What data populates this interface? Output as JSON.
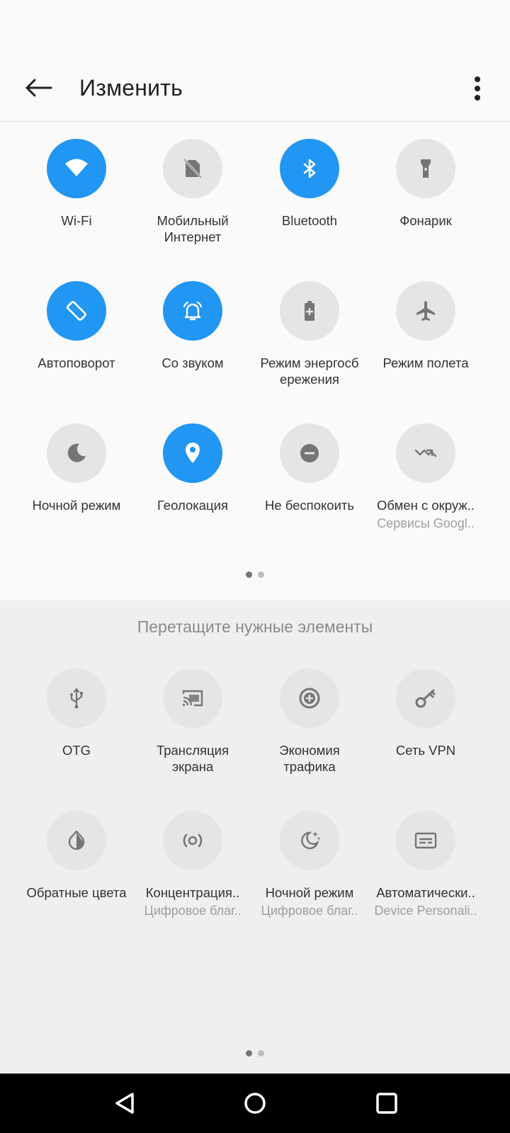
{
  "header": {
    "title": "Изменить"
  },
  "active_tiles": [
    {
      "name": "wifi",
      "label": "Wi-Fi",
      "sub": "",
      "on": true,
      "icon": "wifi-icon"
    },
    {
      "name": "mobile-data",
      "label": "Мобильный\nИнтернет",
      "sub": "",
      "on": false,
      "icon": "no-sim-icon"
    },
    {
      "name": "bluetooth",
      "label": "Bluetooth",
      "sub": "",
      "on": true,
      "icon": "bluetooth-icon"
    },
    {
      "name": "flashlight",
      "label": "Фонарик",
      "sub": "",
      "on": false,
      "icon": "flashlight-icon"
    },
    {
      "name": "autorotate",
      "label": "Автоповорот",
      "sub": "",
      "on": true,
      "icon": "rotate-icon"
    },
    {
      "name": "sound",
      "label": "Со звуком",
      "sub": "",
      "on": true,
      "icon": "bell-icon"
    },
    {
      "name": "battery-saver",
      "label": "Режим энергосб\nережения",
      "sub": "",
      "on": false,
      "icon": "battery-plus-icon"
    },
    {
      "name": "airplane",
      "label": "Режим полета",
      "sub": "",
      "on": false,
      "icon": "airplane-icon"
    },
    {
      "name": "night-mode",
      "label": "Ночной режим",
      "sub": "",
      "on": false,
      "icon": "moon-icon"
    },
    {
      "name": "location",
      "label": "Геолокация",
      "sub": "",
      "on": true,
      "icon": "location-pin-icon"
    },
    {
      "name": "dnd",
      "label": "Не беспокоить",
      "sub": "",
      "on": false,
      "icon": "minus-circle-icon"
    },
    {
      "name": "nearby-share",
      "label": "Обмен с окруж..",
      "sub": "Сервисы Googl..",
      "on": false,
      "icon": "nearby-share-icon"
    }
  ],
  "drag_hint": "Перетащите нужные элементы",
  "available_tiles": [
    {
      "name": "otg",
      "label": "OTG",
      "sub": "",
      "on": false,
      "icon": "usb-icon"
    },
    {
      "name": "cast",
      "label": "Трансляция\nэкрана",
      "sub": "",
      "on": false,
      "icon": "cast-icon"
    },
    {
      "name": "data-saver",
      "label": "Экономия\nтрафика",
      "sub": "",
      "on": false,
      "icon": "data-saver-icon"
    },
    {
      "name": "vpn",
      "label": "Сеть VPN",
      "sub": "",
      "on": false,
      "icon": "key-icon"
    },
    {
      "name": "invert-colors",
      "label": "Обратные цвета",
      "sub": "",
      "on": false,
      "icon": "invert-colors-icon"
    },
    {
      "name": "focus-mode",
      "label": "Концентрация..",
      "sub": "Цифровое благ..",
      "on": false,
      "icon": "focus-icon"
    },
    {
      "name": "bedtime-mode",
      "label": "Ночной режим",
      "sub": "Цифровое благ..",
      "on": false,
      "icon": "bedtime-icon"
    },
    {
      "name": "auto-caption",
      "label": "Автоматически..",
      "sub": "Device Personali..",
      "on": false,
      "icon": "caption-icon"
    }
  ],
  "colors": {
    "accent": "#2196f3",
    "tile_off": "#e5e5e5",
    "icon_off": "#757575"
  }
}
